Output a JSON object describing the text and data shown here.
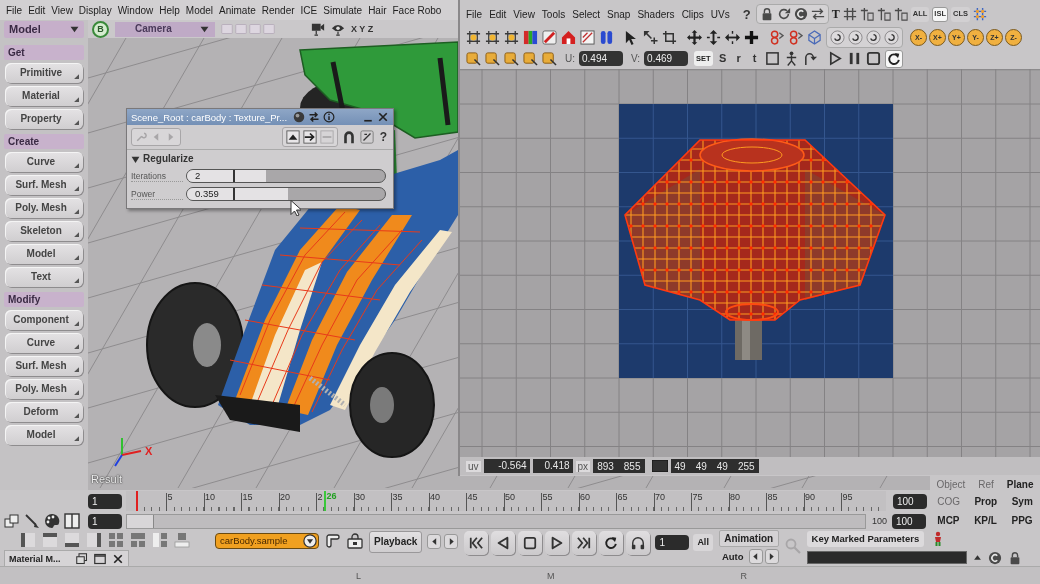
{
  "menubar": {
    "items": [
      "File",
      "Edit",
      "View",
      "Display",
      "Window",
      "Help",
      "Model",
      "Animate",
      "Render",
      "ICE",
      "Simulate",
      "Hair",
      "Face Robo"
    ]
  },
  "toolbar": {
    "mode": "Model",
    "sections": [
      {
        "title": "Get",
        "buttons": [
          "Primitive",
          "Material",
          "Property"
        ]
      },
      {
        "title": "Create",
        "buttons": [
          "Curve",
          "Surf. Mesh",
          "Poly. Mesh",
          "Skeleton",
          "Model",
          "Text"
        ]
      },
      {
        "title": "Modify",
        "buttons": [
          "Component",
          "Curve",
          "Surf. Mesh",
          "Poly. Mesh",
          "Deform",
          "Model"
        ]
      }
    ]
  },
  "viewport": {
    "view_letter": "B",
    "camera": "Camera",
    "axes": "X Y Z",
    "axis_label": "X",
    "label": "Result"
  },
  "property_editor": {
    "title": "Scene_Root : carBody : Texture_Pr...",
    "help": "?",
    "section": {
      "title": "Regularize",
      "expanded": true
    },
    "params": [
      {
        "label": "Iterations",
        "value": "2",
        "level": 0.4
      },
      {
        "label": "Power",
        "value": "0.359",
        "level": 0.51
      }
    ]
  },
  "uv_editor": {
    "menus": [
      "File",
      "Edit",
      "View",
      "Tools",
      "Select",
      "Snap",
      "Shaders",
      "Clips",
      "UVs"
    ],
    "help": "?",
    "text_tool": "T",
    "selection_modes": [
      {
        "label": "ALL",
        "selected": false
      },
      {
        "label": "ISL",
        "selected": true
      },
      {
        "label": "CLS",
        "selected": false
      }
    ],
    "axis_buttons": [
      "X-",
      "X+",
      "Y+",
      "Y-",
      "Z+",
      "Z-"
    ],
    "u_label": "U:",
    "u_value": "0.494",
    "v_label": "V:",
    "v_value": "0.469",
    "set_button": "SET",
    "transform_buttons": [
      "S",
      "r",
      "t"
    ],
    "loop_button": {
      "on": true
    },
    "status": {
      "uv_label": "uv",
      "u": "-0.564",
      "v": "0.418",
      "px_label": "px",
      "px": [
        "893",
        "855"
      ],
      "rgba": [
        "49",
        "49",
        "49",
        "255"
      ]
    }
  },
  "side_panel": {
    "tabs": [
      {
        "label": "Object",
        "disabled": true
      },
      {
        "label": "Ref",
        "disabled": true
      },
      {
        "label": "Plane",
        "disabled": false
      }
    ],
    "row_1": [
      {
        "label": "COG",
        "disabled": true
      },
      {
        "label": "Prop",
        "disabled": false
      },
      {
        "label": "Sym",
        "disabled": false
      }
    ],
    "row_2": [
      {
        "label": "MCP",
        "disabled": false
      },
      {
        "label": "KP/L",
        "disabled": false
      },
      {
        "label": "PPG",
        "disabled": false
      }
    ]
  },
  "timeline": {
    "start": "1",
    "range_start": "1",
    "ticks": [
      "5",
      "10",
      "15",
      "20",
      "2",
      "30",
      "35",
      "40",
      "45",
      "50",
      "55",
      "60",
      "65",
      "70",
      "75",
      "80",
      "85",
      "90",
      "95"
    ],
    "current_frame": "26",
    "range_slider": {
      "level": 0.035
    },
    "range_end_label": "100",
    "end": "100",
    "range_end": "100"
  },
  "playback": {
    "clip": "carBody.sample",
    "playback_button": "Playback",
    "frame": "1",
    "all_button": "All",
    "animation_button": "Animation",
    "auto_button": "Auto",
    "key_button": "Key Marked Parameters"
  },
  "docked_tab": {
    "label": "Material M..."
  },
  "status_bar": {
    "mouse_buttons": [
      "L",
      "M",
      "R"
    ]
  }
}
